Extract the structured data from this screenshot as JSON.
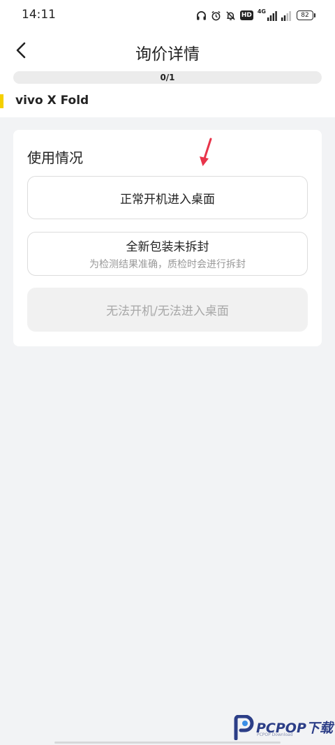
{
  "status": {
    "time": "14:11",
    "network_label": "4G",
    "hd_label": "HD",
    "battery": "82"
  },
  "header": {
    "title": "询价详情"
  },
  "progress": {
    "text": "0/1",
    "fraction": 0.0,
    "accent": "#ffd400"
  },
  "model": {
    "name": "vivo X Fold"
  },
  "usage": {
    "title": "使用情况",
    "options": [
      {
        "label": "正常开机进入桌面"
      },
      {
        "label": "全新包装未拆封",
        "sub": "为检测结果准确，质检时会进行拆封"
      },
      {
        "label": "无法开机/无法进入桌面"
      }
    ]
  },
  "watermark": {
    "brand": "PCPOP下载",
    "sub": "PCPOP Download"
  },
  "colors": {
    "arrow": "#e8344a",
    "brand_blue": "#2c3e87"
  }
}
